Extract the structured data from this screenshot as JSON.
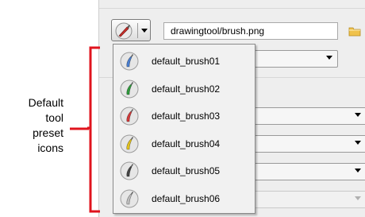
{
  "toolbar": {
    "path_value": "drawingtool/brush.png"
  },
  "presets": [
    {
      "label": "default_brush01",
      "color": "#4a7fd0",
      "icon": "brush-blue-icon"
    },
    {
      "label": "default_brush02",
      "color": "#2f9a3c",
      "icon": "brush-green-icon"
    },
    {
      "label": "default_brush03",
      "color": "#d23a3a",
      "icon": "brush-red-icon"
    },
    {
      "label": "default_brush04",
      "color": "#e2c21d",
      "icon": "brush-yellow-icon"
    },
    {
      "label": "default_brush05",
      "color": "#444444",
      "icon": "brush-black-icon"
    },
    {
      "label": "default_brush06",
      "color": "#bdbdbd",
      "icon": "brush-gray-icon"
    }
  ],
  "callout": {
    "lines": [
      "Default",
      "tool",
      "preset",
      "icons"
    ]
  },
  "colors": {
    "bracket": "#e0141e",
    "panel": "#eeeeee",
    "menu": "#f1f1f1"
  }
}
